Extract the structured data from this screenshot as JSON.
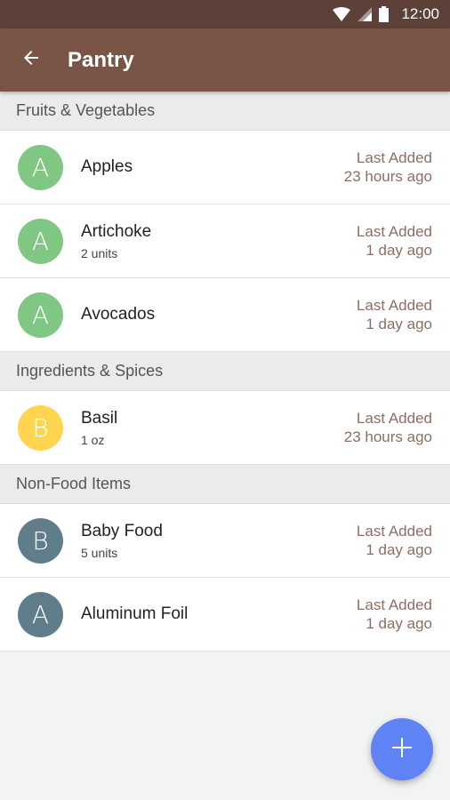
{
  "status_bar": {
    "time": "12:00"
  },
  "app_bar": {
    "title": "Pantry",
    "back_icon": "arrow-left-icon"
  },
  "colors": {
    "status_bar": "#5d4037",
    "app_bar": "#795548",
    "avatar_green": "#81c784",
    "avatar_yellow": "#ffd54f",
    "avatar_slate": "#607d8b",
    "fab": "#5f83f5"
  },
  "sections": [
    {
      "title": "Fruits & Vegetables",
      "items": [
        {
          "letter": "A",
          "name": "Apples",
          "qty": "",
          "meta_label": "Last Added",
          "meta_value": "23 hours ago"
        },
        {
          "letter": "A",
          "name": "Artichoke",
          "qty": "2 units",
          "meta_label": "Last Added",
          "meta_value": "1 day ago"
        },
        {
          "letter": "A",
          "name": "Avocados",
          "qty": "",
          "meta_label": "Last Added",
          "meta_value": "1 day ago"
        }
      ]
    },
    {
      "title": "Ingredients & Spices",
      "items": [
        {
          "letter": "B",
          "name": "Basil",
          "qty": "1 oz",
          "meta_label": "Last Added",
          "meta_value": "23 hours ago"
        }
      ]
    },
    {
      "title": "Non-Food Items",
      "items": [
        {
          "letter": "B",
          "name": "Baby Food",
          "qty": "5 units",
          "meta_label": "Last Added",
          "meta_value": "1 day ago"
        },
        {
          "letter": "A",
          "name": "Aluminum Foil",
          "qty": "",
          "meta_label": "Last Added",
          "meta_value": "1 day ago"
        }
      ]
    }
  ],
  "fab": {
    "icon": "plus-icon"
  }
}
